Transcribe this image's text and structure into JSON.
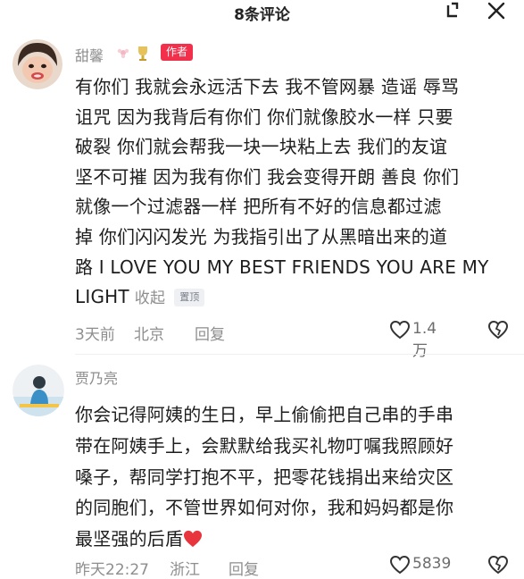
{
  "header": {
    "title": "8条评论",
    "expand_icon": "collapse-corner-icon",
    "close_icon": "close-icon"
  },
  "comments": [
    {
      "username": "甜馨",
      "badge_icons": [
        "flower-icon",
        "trophy-icon"
      ],
      "author_badge": "作者",
      "lines": [
        "有你们 我就会永远活下去 我不管网暴 造谣 辱骂",
        "诅咒 因为我背后有你们 你们就像胶水一样 只要",
        "破裂 你们就会帮我一块一块粘上去 我们的友谊",
        "坚不可摧 因为我有你们 我会变得开朗 善良 你们",
        "就像一个过滤器一样 把所有不好的信息都过滤",
        "掉 你们闪闪发光 为我指引出了从黑暗出来的道",
        "路 I LOVE YOU MY BEST FRIENDS YOU ARE MY",
        "LIGHT"
      ],
      "collapse_label": "收起",
      "pinned_label": "置顶",
      "time": "3天前",
      "location": "北京",
      "reply_label": "回复",
      "likes": "1.4万"
    },
    {
      "username": "贾乃亮",
      "lines": [
        "你会记得阿姨的生日，早上偷偷把自己串的手串",
        "带在阿姨手上，会默默给我买礼物叮嘱我照顾好",
        "嗓子，帮同学打抱不平，把零花钱捐出来给灾区",
        "的同胞们，不管世界如何对你，我和妈妈都是你",
        "最坚强的后盾"
      ],
      "emoji": "red-heart-emoji",
      "time": "昨天22:27",
      "location": "浙江",
      "reply_label": "回复",
      "likes": "5839"
    }
  ],
  "colors": {
    "author_badge": "#f2304c",
    "meta_text": "#8e8e8e",
    "heart": "#e8353d"
  }
}
